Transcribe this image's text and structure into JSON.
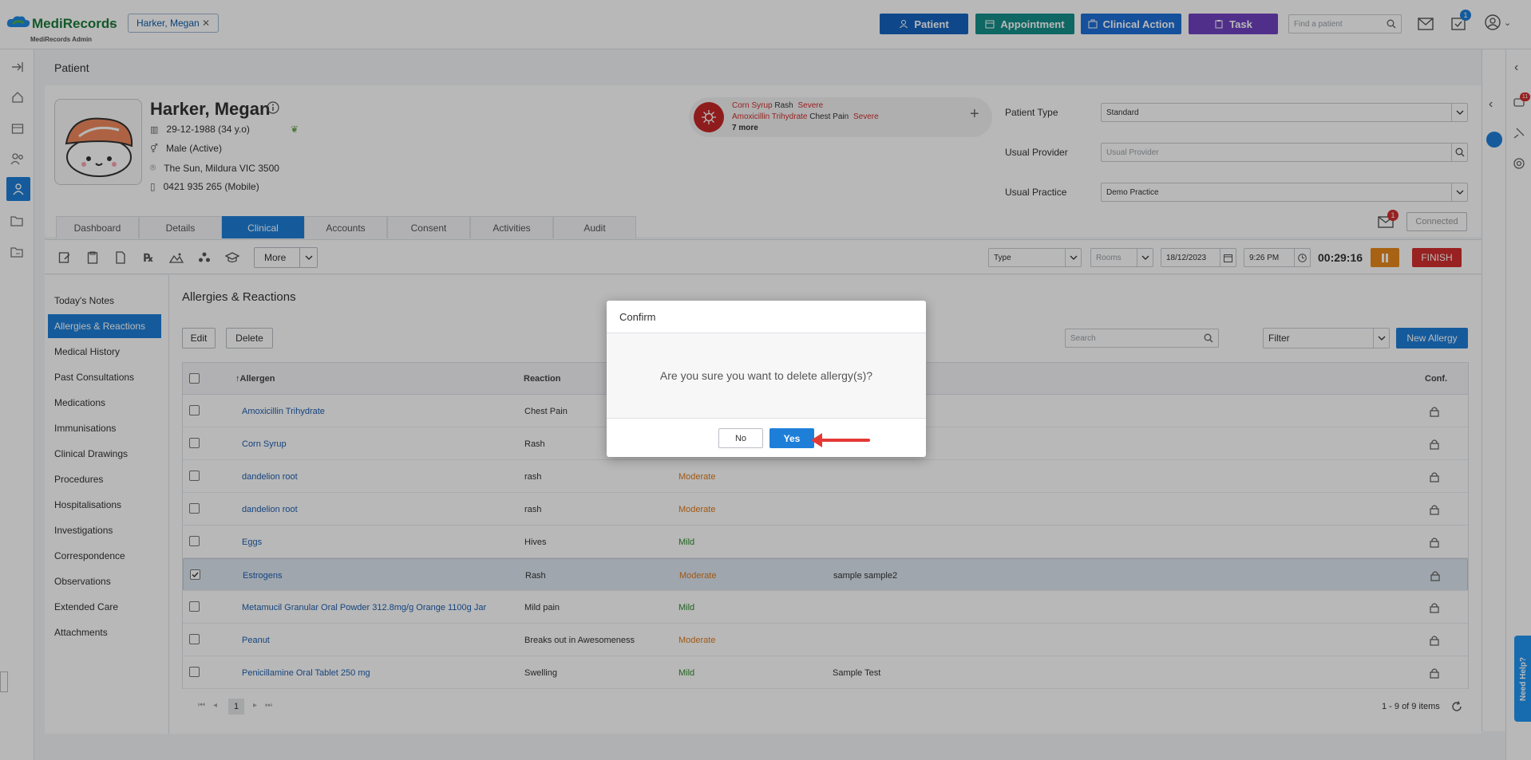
{
  "app": {
    "name": "MediRecords",
    "subtitle": "MediRecords Admin"
  },
  "patient_tab": {
    "label": "Harker, Megan"
  },
  "top_buttons": {
    "patient": {
      "label": "Patient",
      "color": "#1565c0"
    },
    "appointment": {
      "label": "Appointment",
      "color": "#148f8a"
    },
    "clinical_action": {
      "label": "Clinical Action",
      "color": "#1e6fd9"
    },
    "task": {
      "label": "Task",
      "color": "#6f42c1"
    }
  },
  "find_patient": {
    "placeholder": "Find a patient"
  },
  "notif_badge": "1",
  "page_title": "Patient",
  "patient": {
    "name": "Harker, Megan",
    "dob": "29-12-1988 (34 y.o)",
    "gender": "Male (Active)",
    "address": "The Sun, Mildura VIC 3500",
    "phone": "0421 935 265 (Mobile)"
  },
  "alerts": {
    "a1": {
      "allergen": "Corn Syrup",
      "reaction": "Rash",
      "severity": "Severe"
    },
    "a2": {
      "allergen": "Amoxicillin Trihydrate",
      "reaction": "Chest Pain",
      "severity": "Severe"
    },
    "more": "7 more"
  },
  "fields": {
    "patient_type": {
      "label": "Patient Type",
      "value": "Standard"
    },
    "usual_provider": {
      "label": "Usual Provider",
      "placeholder": "Usual Provider"
    },
    "usual_practice": {
      "label": "Usual Practice",
      "value": "Demo Practice"
    }
  },
  "connected": {
    "label": "Connected",
    "badge": "1"
  },
  "tabs": [
    "Dashboard",
    "Details",
    "Clinical",
    "Accounts",
    "Consent",
    "Activities",
    "Audit"
  ],
  "toolbar": {
    "more": "More",
    "type": "Type",
    "rooms": "Rooms",
    "date": "18/12/2023",
    "time": "9:26 PM",
    "timer": "00:29:16",
    "finish": "FINISH"
  },
  "side_menu": [
    "Today's Notes",
    "Allergies & Reactions",
    "Medical History",
    "Past Consultations",
    "Medications",
    "Immunisations",
    "Clinical Drawings",
    "Procedures",
    "Hospitalisations",
    "Investigations",
    "Correspondence",
    "Observations",
    "Extended Care",
    "Attachments"
  ],
  "section": {
    "title": "Allergies & Reactions",
    "edit": "Edit",
    "delete": "Delete",
    "search_placeholder": "Search",
    "filter": "Filter",
    "new_allergy": "New Allergy"
  },
  "table": {
    "headers": {
      "allergen": "Allergen",
      "reaction": "Reaction",
      "conf": "Conf."
    },
    "rows": [
      {
        "allergen": "Amoxicillin Trihydrate",
        "reaction": "Chest Pain",
        "severity": "",
        "note": "",
        "checked": false
      },
      {
        "allergen": "Corn Syrup",
        "reaction": "Rash",
        "severity": "",
        "note": "",
        "checked": false
      },
      {
        "allergen": "dandelion root",
        "reaction": "rash",
        "severity": "Moderate",
        "note": "",
        "checked": false
      },
      {
        "allergen": "dandelion root",
        "reaction": "rash",
        "severity": "Moderate",
        "note": "",
        "checked": false
      },
      {
        "allergen": "Eggs",
        "reaction": "Hives",
        "severity": "Mild",
        "note": "",
        "checked": false
      },
      {
        "allergen": "Estrogens",
        "reaction": "Rash",
        "severity": "Moderate",
        "note": "sample sample2",
        "checked": true
      },
      {
        "allergen": "Metamucil Granular Oral Powder 312.8mg/g Orange 1100g Jar",
        "reaction": "Mild pain",
        "severity": "Mild",
        "note": "",
        "checked": false
      },
      {
        "allergen": "Peanut",
        "reaction": "Breaks out in Awesomeness",
        "severity": "Moderate",
        "note": "",
        "checked": false
      },
      {
        "allergen": "Penicillamine Oral Tablet 250 mg",
        "reaction": "Swelling",
        "severity": "Mild",
        "note": "Sample Test",
        "checked": false
      }
    ]
  },
  "pagination": {
    "page": "1",
    "summary": "1 - 9 of 9 items"
  },
  "dialog": {
    "title": "Confirm",
    "message": "Are you sure you want to delete allergy(s)?",
    "no": "No",
    "yes": "Yes"
  },
  "need_help": "Need Help?",
  "right_badge": "11",
  "colors": {
    "moderate": "#e07b1a",
    "mild": "#2e8b2e",
    "severe": "#d32f2f",
    "accent": "#1e7fd8"
  }
}
